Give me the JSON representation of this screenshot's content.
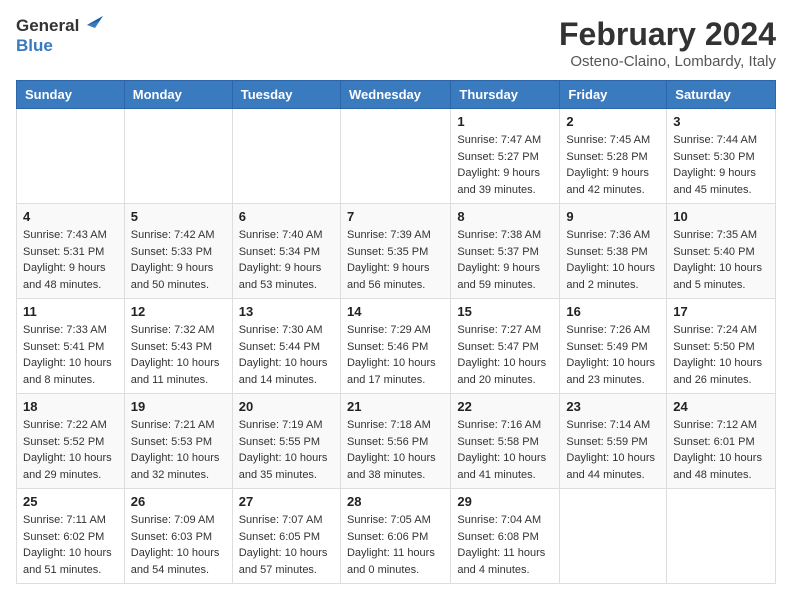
{
  "header": {
    "logo_general": "General",
    "logo_blue": "Blue",
    "title": "February 2024",
    "subtitle": "Osteno-Claino, Lombardy, Italy"
  },
  "weekdays": [
    "Sunday",
    "Monday",
    "Tuesday",
    "Wednesday",
    "Thursday",
    "Friday",
    "Saturday"
  ],
  "weeks": [
    [
      {
        "day": "",
        "info": ""
      },
      {
        "day": "",
        "info": ""
      },
      {
        "day": "",
        "info": ""
      },
      {
        "day": "",
        "info": ""
      },
      {
        "day": "1",
        "info": "Sunrise: 7:47 AM\nSunset: 5:27 PM\nDaylight: 9 hours\nand 39 minutes."
      },
      {
        "day": "2",
        "info": "Sunrise: 7:45 AM\nSunset: 5:28 PM\nDaylight: 9 hours\nand 42 minutes."
      },
      {
        "day": "3",
        "info": "Sunrise: 7:44 AM\nSunset: 5:30 PM\nDaylight: 9 hours\nand 45 minutes."
      }
    ],
    [
      {
        "day": "4",
        "info": "Sunrise: 7:43 AM\nSunset: 5:31 PM\nDaylight: 9 hours\nand 48 minutes."
      },
      {
        "day": "5",
        "info": "Sunrise: 7:42 AM\nSunset: 5:33 PM\nDaylight: 9 hours\nand 50 minutes."
      },
      {
        "day": "6",
        "info": "Sunrise: 7:40 AM\nSunset: 5:34 PM\nDaylight: 9 hours\nand 53 minutes."
      },
      {
        "day": "7",
        "info": "Sunrise: 7:39 AM\nSunset: 5:35 PM\nDaylight: 9 hours\nand 56 minutes."
      },
      {
        "day": "8",
        "info": "Sunrise: 7:38 AM\nSunset: 5:37 PM\nDaylight: 9 hours\nand 59 minutes."
      },
      {
        "day": "9",
        "info": "Sunrise: 7:36 AM\nSunset: 5:38 PM\nDaylight: 10 hours\nand 2 minutes."
      },
      {
        "day": "10",
        "info": "Sunrise: 7:35 AM\nSunset: 5:40 PM\nDaylight: 10 hours\nand 5 minutes."
      }
    ],
    [
      {
        "day": "11",
        "info": "Sunrise: 7:33 AM\nSunset: 5:41 PM\nDaylight: 10 hours\nand 8 minutes."
      },
      {
        "day": "12",
        "info": "Sunrise: 7:32 AM\nSunset: 5:43 PM\nDaylight: 10 hours\nand 11 minutes."
      },
      {
        "day": "13",
        "info": "Sunrise: 7:30 AM\nSunset: 5:44 PM\nDaylight: 10 hours\nand 14 minutes."
      },
      {
        "day": "14",
        "info": "Sunrise: 7:29 AM\nSunset: 5:46 PM\nDaylight: 10 hours\nand 17 minutes."
      },
      {
        "day": "15",
        "info": "Sunrise: 7:27 AM\nSunset: 5:47 PM\nDaylight: 10 hours\nand 20 minutes."
      },
      {
        "day": "16",
        "info": "Sunrise: 7:26 AM\nSunset: 5:49 PM\nDaylight: 10 hours\nand 23 minutes."
      },
      {
        "day": "17",
        "info": "Sunrise: 7:24 AM\nSunset: 5:50 PM\nDaylight: 10 hours\nand 26 minutes."
      }
    ],
    [
      {
        "day": "18",
        "info": "Sunrise: 7:22 AM\nSunset: 5:52 PM\nDaylight: 10 hours\nand 29 minutes."
      },
      {
        "day": "19",
        "info": "Sunrise: 7:21 AM\nSunset: 5:53 PM\nDaylight: 10 hours\nand 32 minutes."
      },
      {
        "day": "20",
        "info": "Sunrise: 7:19 AM\nSunset: 5:55 PM\nDaylight: 10 hours\nand 35 minutes."
      },
      {
        "day": "21",
        "info": "Sunrise: 7:18 AM\nSunset: 5:56 PM\nDaylight: 10 hours\nand 38 minutes."
      },
      {
        "day": "22",
        "info": "Sunrise: 7:16 AM\nSunset: 5:58 PM\nDaylight: 10 hours\nand 41 minutes."
      },
      {
        "day": "23",
        "info": "Sunrise: 7:14 AM\nSunset: 5:59 PM\nDaylight: 10 hours\nand 44 minutes."
      },
      {
        "day": "24",
        "info": "Sunrise: 7:12 AM\nSunset: 6:01 PM\nDaylight: 10 hours\nand 48 minutes."
      }
    ],
    [
      {
        "day": "25",
        "info": "Sunrise: 7:11 AM\nSunset: 6:02 PM\nDaylight: 10 hours\nand 51 minutes."
      },
      {
        "day": "26",
        "info": "Sunrise: 7:09 AM\nSunset: 6:03 PM\nDaylight: 10 hours\nand 54 minutes."
      },
      {
        "day": "27",
        "info": "Sunrise: 7:07 AM\nSunset: 6:05 PM\nDaylight: 10 hours\nand 57 minutes."
      },
      {
        "day": "28",
        "info": "Sunrise: 7:05 AM\nSunset: 6:06 PM\nDaylight: 11 hours\nand 0 minutes."
      },
      {
        "day": "29",
        "info": "Sunrise: 7:04 AM\nSunset: 6:08 PM\nDaylight: 11 hours\nand 4 minutes."
      },
      {
        "day": "",
        "info": ""
      },
      {
        "day": "",
        "info": ""
      }
    ]
  ]
}
